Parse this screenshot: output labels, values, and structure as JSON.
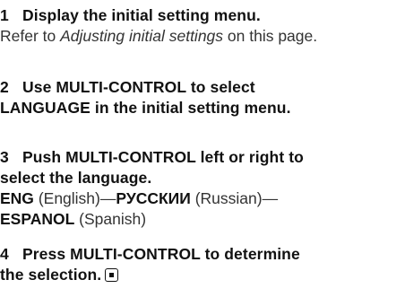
{
  "steps": [
    {
      "number": "1",
      "heading": "Display the initial setting menu.",
      "body": {
        "before": "Refer to ",
        "emphasis": "Adjusting initial settings",
        "after": " on this page."
      }
    },
    {
      "number": "2",
      "heading_line1": "Use MULTI-CONTROL to select",
      "heading_line2": "LANGUAGE in the initial setting menu."
    },
    {
      "number": "3",
      "heading_line1": "Push MULTI-CONTROL left or right to",
      "heading_line2": "select the language.",
      "languages": [
        {
          "code": "ENG",
          "name": "(English)",
          "sep": "—"
        },
        {
          "code": "РУССКИИ",
          "name": "(Russian)",
          "sep": "—"
        },
        {
          "code": "ESPANOL",
          "name": "(Spanish)",
          "sep": ""
        }
      ]
    },
    {
      "number": "4",
      "heading_line1": "Press MULTI-CONTROL to determine",
      "heading_line2": "the selection.",
      "end_icon": "end-of-section-icon"
    }
  ]
}
